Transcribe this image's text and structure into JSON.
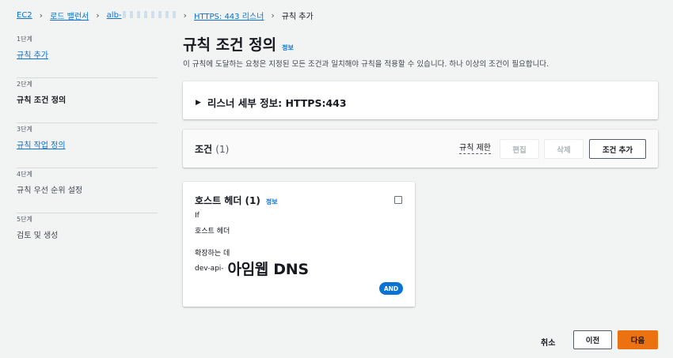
{
  "breadcrumb": {
    "items": [
      "EC2",
      "로드 밸런서",
      "alb-",
      "HTTPS: 443 리스너"
    ],
    "current": "규칙 추가"
  },
  "steps": [
    {
      "num": "1단계",
      "label": "규칙 추가"
    },
    {
      "num": "2단계",
      "label": "규칙 조건 정의"
    },
    {
      "num": "3단계",
      "label": "규칙 작업 정의"
    },
    {
      "num": "4단계",
      "label": "규칙 우선 순위 설정"
    },
    {
      "num": "5단계",
      "label": "검토 및 생성"
    }
  ],
  "header": {
    "title": "규칙 조건 정의",
    "info": "정보",
    "description": "이 규칙에 도달하는 요청은 지정된 모든 조건과 일치해야 규칙을 적용할 수 있습니다. 하나 이상의 조건이 필요합니다."
  },
  "listener": {
    "label": "리스너 세부 정보: HTTPS:443"
  },
  "conditions": {
    "title": "조건",
    "count": "(1)",
    "limit_label": "규칙 제한",
    "edit_label": "편집",
    "delete_label": "삭제",
    "add_label": "조건 추가"
  },
  "host_card": {
    "title": "호스트 헤더 (1)",
    "info": "정보",
    "if_label": "If",
    "field_label": "호스트 헤더",
    "match_label": "확장하는 데",
    "value_prefix": "dev-api-",
    "value_main": "아임웹 DNS",
    "badge": "AND"
  },
  "footer": {
    "cancel": "취소",
    "prev": "이전",
    "next": "다음"
  },
  "colors": {
    "link": "#0972d3",
    "primary": "#ec7211",
    "background": "#f2f3f3"
  }
}
